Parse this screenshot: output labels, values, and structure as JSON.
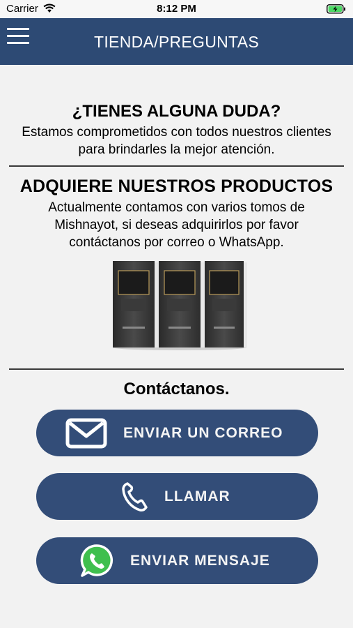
{
  "status_bar": {
    "carrier": "Carrier",
    "time": "8:12 PM"
  },
  "nav": {
    "title": "TIENDA/PREGUNTAS",
    "menu_icon": "hamburger-menu-icon"
  },
  "faq": {
    "heading": "¿TIENES ALGUNA DUDA?",
    "text": "Estamos comprometidos con todos nuestros clientes para brindarles la mejor atención."
  },
  "products": {
    "heading": "ADQUIERE NUESTROS PRODUCTOS",
    "text": "Actualmente contamos con varios tomos de Mishnayot, si deseas adquirirlos por favor contáctanos por correo o WhatsApp."
  },
  "contact": {
    "heading": "Contáctanos.",
    "buttons": [
      {
        "label": "ENVIAR UN CORREO",
        "icon": "envelope-icon"
      },
      {
        "label": "LLAMAR",
        "icon": "phone-icon"
      },
      {
        "label": "ENVIAR MENSAJE",
        "icon": "whatsapp-icon"
      }
    ]
  },
  "colors": {
    "nav_bar": "#2d4a74",
    "button": "#334d78",
    "background": "#f2f2f2",
    "whatsapp": "#3fbf4e"
  }
}
